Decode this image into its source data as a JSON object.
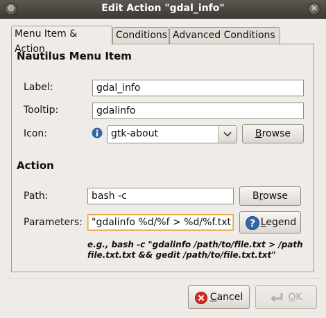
{
  "window": {
    "title": "Edit Action \"gdal_info\""
  },
  "tabs": [
    {
      "label": "Menu Item & Action",
      "active": true
    },
    {
      "label": "Conditions",
      "active": false
    },
    {
      "label": "Advanced Conditions",
      "active": false
    }
  ],
  "menu_item": {
    "section_title": "Nautilus Menu Item",
    "label_caption": "Label:",
    "label_value": "gdal_info",
    "tooltip_caption": "Tooltip:",
    "tooltip_value": "gdalinfo",
    "icon_caption": "Icon:",
    "icon_value": "gtk-about",
    "browse_label_pre": "",
    "browse_label_mnemonic": "B",
    "browse_label_post": "rowse"
  },
  "action": {
    "section_title": "Action",
    "path_caption": "Path:",
    "path_value": "bash -c",
    "path_browse_pre": "B",
    "path_browse_mnemonic": "r",
    "path_browse_post": "owse",
    "params_caption": "Parameters:",
    "params_value": "\"gdalinfo %d/%f > %d/%f.txt &",
    "legend_pre": "",
    "legend_mnemonic": "L",
    "legend_post": "egend",
    "hint_line1": "e.g., bash -c \"gdalinfo /path/to/file.txt > /path",
    "hint_line2": "file.txt.txt && gedit /path/to/file.txt.txt\""
  },
  "footer": {
    "cancel_mnemonic": "C",
    "cancel_post": "ancel",
    "ok_mnemonic": "O",
    "ok_post": "K"
  },
  "colors": {
    "focus_border": "#e5a340",
    "cancel_icon": "#d42a1f",
    "help_icon": "#3465a4",
    "info_icon": "#3465a4"
  }
}
